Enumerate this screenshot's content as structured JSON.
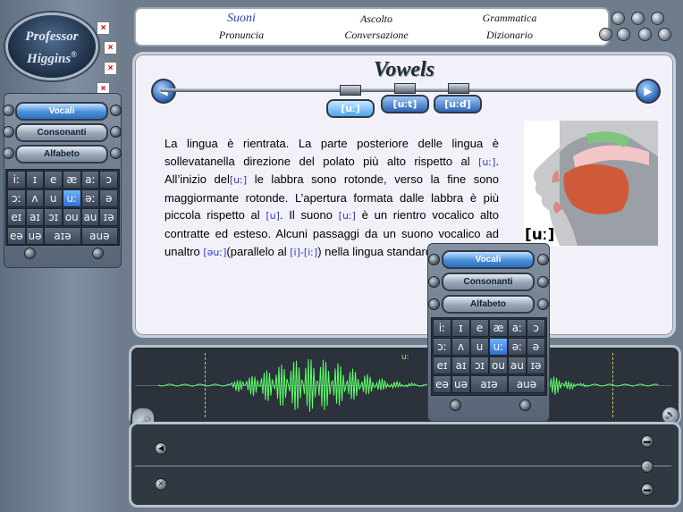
{
  "app": {
    "logo_line1": "Professor",
    "logo_line2": "Higgins",
    "logo_mark": "®"
  },
  "nav": {
    "top": [
      "Suoni",
      "Ascolto",
      "Grammatica"
    ],
    "bottom": [
      "Pronuncia",
      "Conversazione",
      "Dizionario"
    ],
    "active": "Suoni"
  },
  "window_controls": [
    "minimize-icon",
    "restore-icon",
    "close-icon",
    "print-icon",
    "refresh-icon",
    "settings-icon",
    "help-icon"
  ],
  "left_panel": {
    "close_boxes": [
      "×",
      "×",
      "×",
      "×"
    ],
    "buttons": [
      "Vocali",
      "Consonanti",
      "Alfabeto"
    ],
    "active_button": "Vocali",
    "phonemes": [
      [
        "iː",
        "ɪ",
        "e",
        "æ",
        "aː",
        "ɔ"
      ],
      [
        "ɔː",
        "ʌ",
        "u",
        "uː",
        "əː",
        "ə"
      ],
      [
        "eɪ",
        "aɪ",
        "ɔɪ",
        "ou",
        "au",
        "ɪə"
      ],
      [
        "eə",
        "uə",
        "aɪə",
        "auə"
      ]
    ],
    "selected_phoneme": "uː"
  },
  "content": {
    "title": "Vowels",
    "tabs": [
      "[uː]",
      "[uːt]",
      "[uːd]"
    ],
    "active_tab": "[uː]",
    "paragraph": [
      {
        "t": "La lingua è rientrata. La parte posteriore delle lingua è sollevatanella direzione del polato più alto rispetto al "
      },
      {
        "p": "[uː]"
      },
      {
        "t": ". All’inizio del"
      },
      {
        "p": "[uː]"
      },
      {
        "t": " le labbra sono rotonde, verso la fine sono maggiormante rotonde. L’apertura formata dalle labbra è più piccola rispetto al "
      },
      {
        "p": "[u]"
      },
      {
        "t": ". Il suono "
      },
      {
        "p": "[uː]"
      },
      {
        "t": " è un rientro vocalico alto contratte ed esteso. Alcuni passaggi da un suono vocalico ad unaltro "
      },
      {
        "p": "[əuː]"
      },
      {
        "t": "(parallelo al "
      },
      {
        "p": "[i]-[iː]"
      },
      {
        "t": ") nella lingua standard."
      }
    ],
    "mouth_label": "[uː]"
  },
  "popup": {
    "buttons": [
      "Vocali",
      "Consonanti",
      "Alfabeto"
    ],
    "active_button": "Vocali"
  },
  "wave": {
    "marker_label": "uː"
  },
  "colors": {
    "accent": "#2d6fc0",
    "wave": "#5cff6a",
    "phonetic": "#2d3ac0"
  }
}
